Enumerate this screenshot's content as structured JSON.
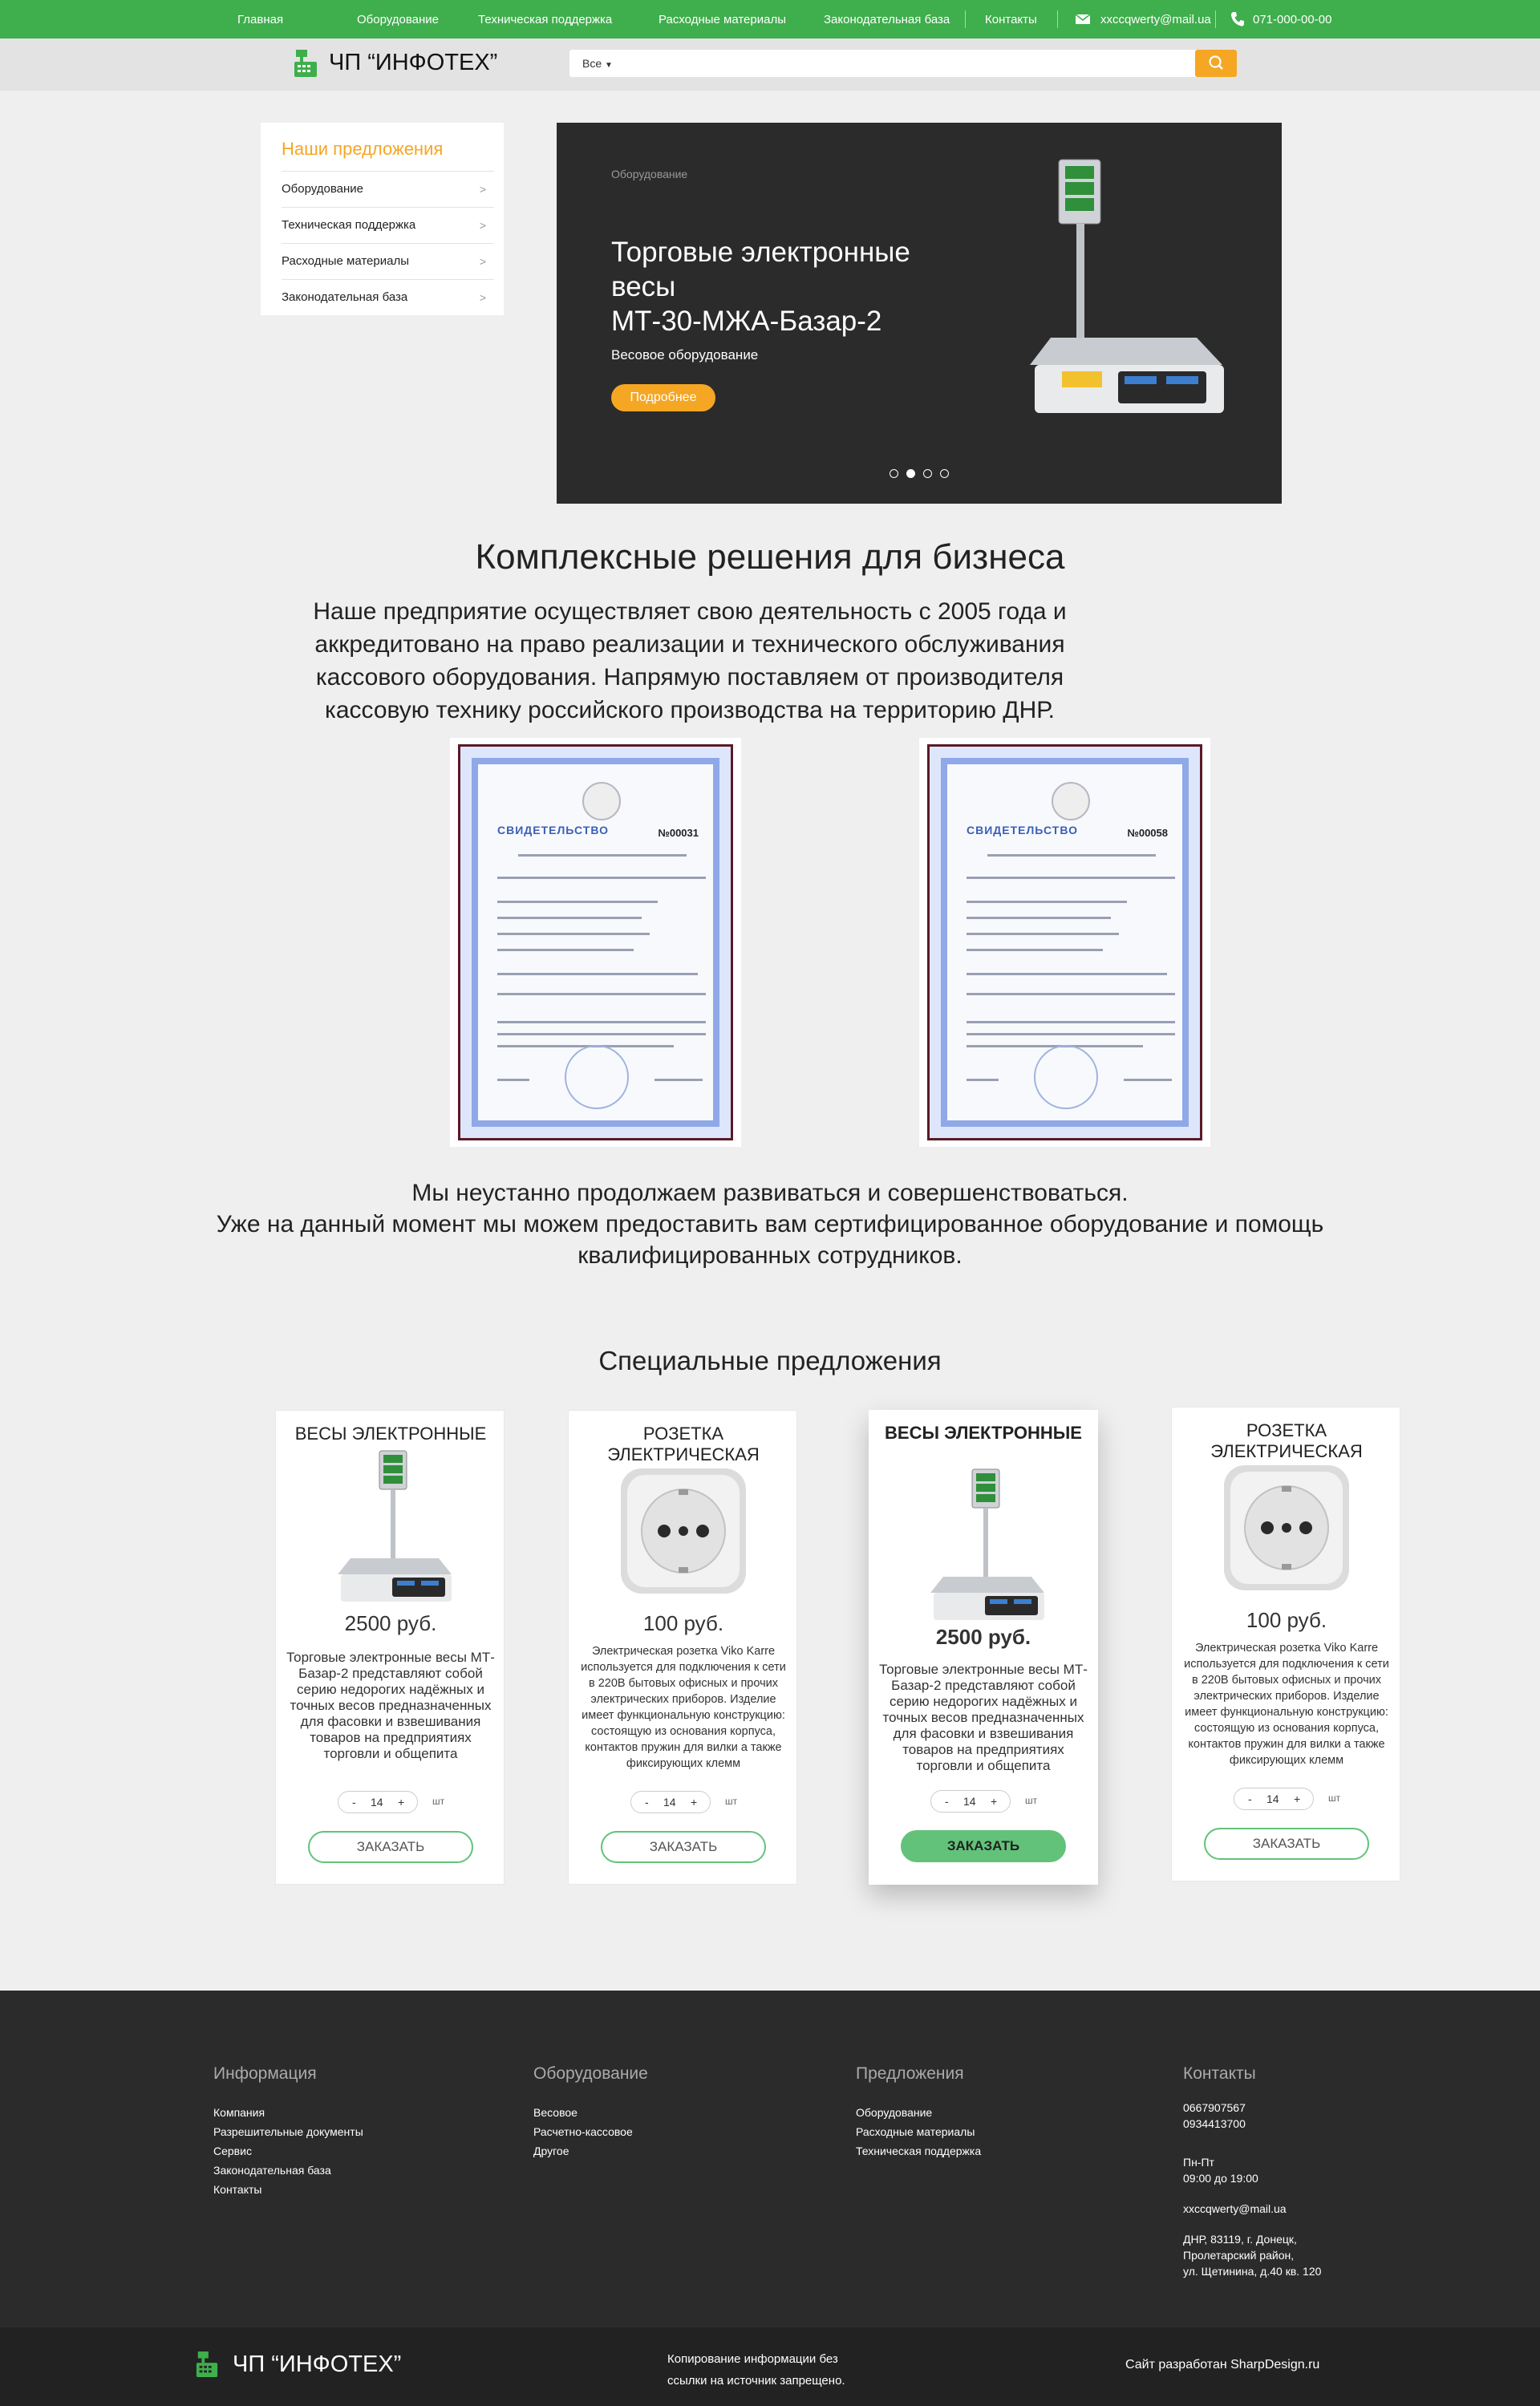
{
  "topbar": {
    "nav": [
      "Главная",
      "Оборудование",
      "Техническая поддержка",
      "Расходные материалы",
      "Законодательная база",
      "Контакты"
    ],
    "email": "xxccqwerty@mail.ua",
    "phone": "071-000-00-00"
  },
  "header": {
    "logo": "ЧП “ИНФОТЕХ”",
    "search_category": "Все",
    "search_placeholder": ""
  },
  "sidebar": {
    "title": "Наши предложения",
    "items": [
      "Оборудование",
      "Техническая поддержка",
      "Расходные материалы",
      "Законодательная база"
    ]
  },
  "hero": {
    "category": "Оборудование",
    "title_line1": "Торговые электронные",
    "title_line2": "весы",
    "title_line3": "МТ-30-МЖА-Базар-2",
    "subtitle": "Весовое оборудование",
    "button": "Подробнее",
    "slides": 4,
    "active_slide": 2
  },
  "intro": {
    "heading": "Комплексные решения для бизнеса",
    "text": "Наше предприятие осуществляет свою деятельность с 2005 года и аккредитовано  на право реализации и технического обслуживания кассового оборудования. Напрямую поставляем от производителя кассовую технику  российского производства на территорию ДНР."
  },
  "certificates": [
    {
      "heading": "СВИДЕТЕЛЬСТВО",
      "number": "№00031"
    },
    {
      "heading": "СВИДЕТЕЛЬСТВО",
      "number": "№00058"
    }
  ],
  "continuation": {
    "line1": "Мы неустанно продолжаем развиваться и совершенствоваться.",
    "line2": "Уже на данный момент мы можем предоставить вам сертифицированное оборудование и помощь квалифицированных сотрудников."
  },
  "offers": {
    "heading": "Специальные предложения",
    "cards": [
      {
        "title": "ВЕСЫ ЭЛЕКТРОННЫЕ",
        "price": "2500 руб.",
        "desc": "Торговые электронные весы МТ-Базар-2 представляют собой серию недорогих надёжных и точных весов предназначенных для фасовки и взвешивания товаров на предприятиях торговли и общепита",
        "qty": "14",
        "unit": "шт",
        "order": "ЗАКАЗАТЬ",
        "image_icon": "scale-icon"
      },
      {
        "title": "РОЗЕТКА ЭЛЕКТРИЧЕСКАЯ",
        "price": "100 руб.",
        "desc": "Электрическая розетка Viko Karre используется для подключения к сети в 220В бытовых офисных и прочих электрических приборов. Изделие имеет функциональную конструкцию: состоящую из основания корпуса, контактов пружин для вилки а также фиксирующих клемм",
        "qty": "14",
        "unit": "шт",
        "order": "ЗАКАЗАТЬ",
        "image_icon": "socket-icon"
      },
      {
        "title": "ВЕСЫ ЭЛЕКТРОННЫЕ",
        "price": "2500 руб.",
        "desc": "Торговые электронные весы МТ-Базар-2 представляют собой серию недорогих надёжных и точных весов предназначенных для фасовки и взвешивания товаров на предприятиях торговли и общепита",
        "qty": "14",
        "unit": "шт",
        "order": "ЗАКАЗАТЬ",
        "image_icon": "scale-icon"
      },
      {
        "title": "РОЗЕТКА ЭЛЕКТРИЧЕСКАЯ",
        "price": "100 руб.",
        "desc": "Электрическая розетка Viko Karre используется для подключения к сети в 220В бытовых офисных и прочих электрических приборов. Изделие имеет функциональную конструкцию: состоящую из основания корпуса, контактов пружин для вилки а также фиксирующих клемм",
        "qty": "14",
        "unit": "шт",
        "order": "ЗАКАЗАТЬ",
        "image_icon": "socket-icon"
      }
    ]
  },
  "footer": {
    "info": {
      "heading": "Информация",
      "items": [
        "Компания",
        "Разрешительные документы",
        "Сервис",
        "Законодательная база",
        "Контакты"
      ]
    },
    "equipment": {
      "heading": "Оборудование",
      "items": [
        "Весовое",
        "Расчетно-кассовое",
        "Другое"
      ]
    },
    "offers": {
      "heading": "Предложения",
      "items": [
        "Оборудование",
        "Расходные материалы",
        "Техническая поддержка"
      ]
    },
    "contacts": {
      "heading": "Контакты",
      "phone1": "0667907567",
      "phone2": "0934413700",
      "days": "Пн-Пт",
      "hours": "09:00 до 19:00",
      "email": "xxccqwerty@mail.ua",
      "address1": "ДНР, 83119, г. Донецк,",
      "address2": "Пролетарский район,",
      "address3": "ул. Щетинина, д.40 кв. 120"
    },
    "logo": "ЧП “ИНФОТЕХ”",
    "copyright1": "Копирование информации без",
    "copyright2": "ссылки на источник запрещено.",
    "developer": "Сайт разработан SharpDesign.ru"
  },
  "colors": {
    "green": "#3fae4c",
    "orange": "#f5a623",
    "dark": "#2b2b2b",
    "button_green": "#62c27a"
  }
}
